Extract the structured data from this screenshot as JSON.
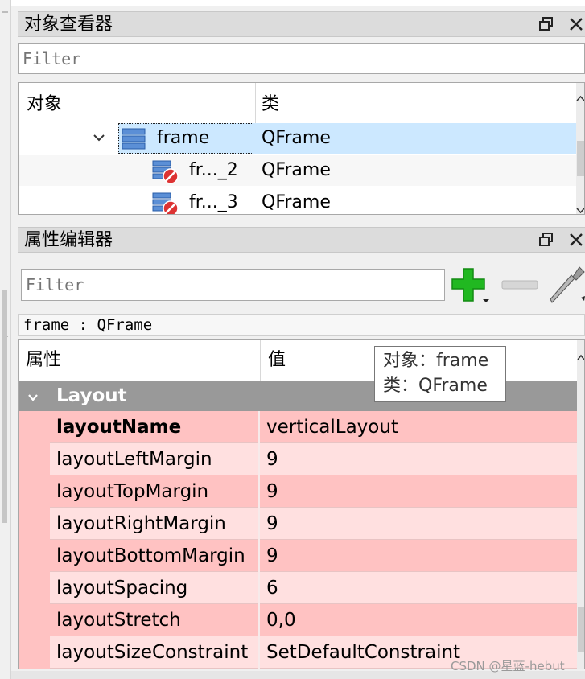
{
  "object_inspector": {
    "title": "对象查看器",
    "filter_placeholder": "Filter",
    "columns": {
      "object": "对象",
      "class": "类"
    },
    "rows": [
      {
        "object": "frame",
        "class": "QFrame"
      },
      {
        "object": "fr..._2",
        "class": "QFrame"
      },
      {
        "object": "fr..._3",
        "class": "QFrame"
      }
    ]
  },
  "property_editor": {
    "title": "属性编辑器",
    "filter_placeholder": "Filter",
    "current_object": "frame : QFrame",
    "columns": {
      "property": "属性",
      "value": "值"
    },
    "group": "Layout",
    "properties": [
      {
        "name": "layoutName",
        "value": "verticalLayout"
      },
      {
        "name": "layoutLeftMargin",
        "value": "9"
      },
      {
        "name": "layoutTopMargin",
        "value": "9"
      },
      {
        "name": "layoutRightMargin",
        "value": "9"
      },
      {
        "name": "layoutBottomMargin",
        "value": "9"
      },
      {
        "name": "layoutSpacing",
        "value": "6"
      },
      {
        "name": "layoutStretch",
        "value": "0,0"
      },
      {
        "name": "layoutSizeConstraint",
        "value": "SetDefaultConstraint"
      }
    ]
  },
  "tooltip": {
    "line1": "对象：frame",
    "line2": "类：QFrame"
  },
  "watermark": "CSDN @星蓝-hebut",
  "colors": {
    "selection": "#cce8ff",
    "group_header": "#999999",
    "row_dark": "#ffc2c2",
    "row_light": "#ffe0e0",
    "add_green": "#21b821"
  },
  "icons": [
    "float-icon",
    "close-icon",
    "chevron-down-icon",
    "layout-widget-icon",
    "broken-layout-icon",
    "add-icon",
    "remove-icon",
    "wrench-icon"
  ]
}
